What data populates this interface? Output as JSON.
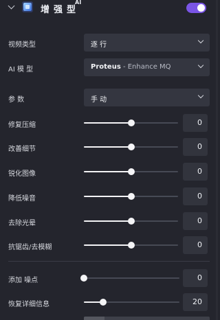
{
  "header": {
    "title": "增强型",
    "superscript": "AI",
    "expanded": true,
    "enabled": true,
    "icon": "cube-icon"
  },
  "video_type": {
    "label": "视频类型",
    "value": "逐 行"
  },
  "ai_model": {
    "label": "AI 模 型",
    "value_bold": "Proteus",
    "value_rest": " - Enhance MQ"
  },
  "params": {
    "label": "参 数",
    "value": "手 动"
  },
  "sliders": [
    {
      "label": "修复压缩",
      "value": "0",
      "fraction": 0.5
    },
    {
      "label": "改善细节",
      "value": "0",
      "fraction": 0.5
    },
    {
      "label": "锐化图像",
      "value": "0",
      "fraction": 0.5
    },
    {
      "label": "降低噪音",
      "value": "0",
      "fraction": 0.5
    },
    {
      "label": "去除光晕",
      "value": "0",
      "fraction": 0.5
    },
    {
      "label": "抗锯齿/去模糊",
      "value": "0",
      "fraction": 0.5
    }
  ],
  "extra_sliders": [
    {
      "label": "添加 噪点",
      "value": "0",
      "fraction": 0.0
    },
    {
      "label": "恢复详细信息",
      "value": "20",
      "fraction": 0.2
    }
  ],
  "colors": {
    "accent": "#7a55e6",
    "background": "#24252d",
    "field": "#343640"
  }
}
